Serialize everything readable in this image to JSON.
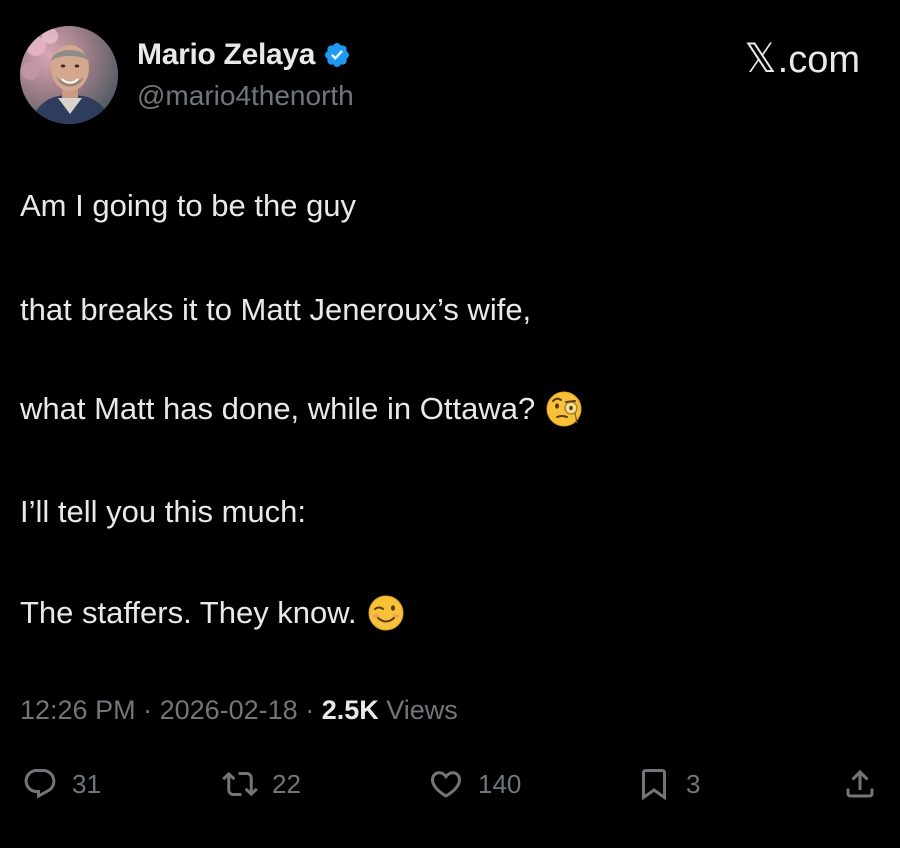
{
  "user": {
    "display_name": "Mario Zelaya",
    "handle": "@mario4thenorth",
    "verified": true,
    "verified_color": "#1d9bf0"
  },
  "brand": {
    "label": ".com",
    "x_glyph": "𝕏"
  },
  "tweet": {
    "lines": [
      "Am I going to be the guy",
      "that breaks it to Matt Jeneroux’s wife,",
      "what Matt has done, while in Ottawa?",
      "I’ll tell you this much:",
      "The staffers. They know."
    ],
    "emojis": [
      "face-with-monocle-emoji",
      "winking-face-emoji"
    ]
  },
  "meta": {
    "time": "12:26 PM",
    "separator": " · ",
    "date": "2026-02-18",
    "views_count": "2.5K",
    "views_label": " Views"
  },
  "actions": {
    "replies": "31",
    "reposts": "22",
    "likes": "140",
    "bookmarks": "3"
  },
  "colors": {
    "background": "#000000",
    "text": "#e7e9ea",
    "secondary": "#71767b",
    "accent": "#1d9bf0"
  }
}
